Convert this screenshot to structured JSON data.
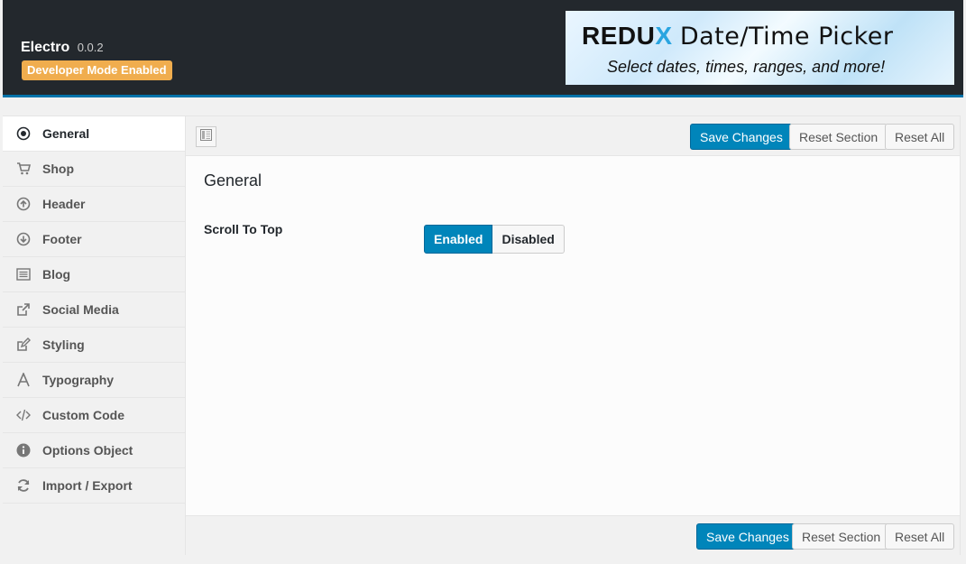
{
  "header": {
    "app_name": "Electro",
    "version": "0.0.2",
    "dev_badge": "Developer Mode Enabled",
    "banner": {
      "brand_prefix": "REDU",
      "brand_x": "X",
      "title": "Date/Time Picker",
      "subtitle": "Select dates, times, ranges, and more!"
    }
  },
  "sidebar": {
    "items": [
      {
        "label": "General",
        "icon": "radio-icon",
        "active": true
      },
      {
        "label": "Shop",
        "icon": "cart-icon"
      },
      {
        "label": "Header",
        "icon": "arrow-up-circle-icon"
      },
      {
        "label": "Footer",
        "icon": "arrow-down-circle-icon"
      },
      {
        "label": "Blog",
        "icon": "list-icon"
      },
      {
        "label": "Social Media",
        "icon": "share-icon"
      },
      {
        "label": "Styling",
        "icon": "edit-icon"
      },
      {
        "label": "Typography",
        "icon": "font-icon"
      },
      {
        "label": "Custom Code",
        "icon": "code-icon"
      },
      {
        "label": "Options Object",
        "icon": "info-icon"
      },
      {
        "label": "Import / Export",
        "icon": "refresh-icon"
      }
    ]
  },
  "toolbar": {
    "save_label": "Save Changes",
    "reset_section_label": "Reset Section",
    "reset_all_label": "Reset All"
  },
  "section": {
    "title": "General",
    "fields": [
      {
        "label": "Scroll To Top",
        "options": [
          "Enabled",
          "Disabled"
        ],
        "selected": "Enabled"
      }
    ]
  },
  "colors": {
    "accent": "#0085ba",
    "header_bg": "#23282d",
    "badge": "#f0ad4e"
  }
}
